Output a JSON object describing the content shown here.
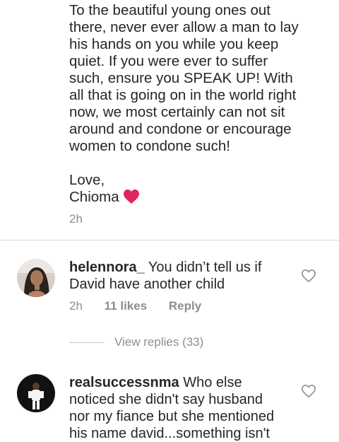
{
  "post": {
    "lines": [
      "To the beautiful young ones out",
      "there, never ever allow a man to lay",
      "his hands on you while you keep",
      "quiet. If you were ever to suffer",
      "such, ensure you SPEAK UP! With",
      "all that is going on in the world right",
      "now, we most certainly can not sit",
      "around and condone or encourage",
      "women to condone such!"
    ],
    "signoff": "Love,",
    "signature": "Chioma",
    "time": "2h"
  },
  "comments": [
    {
      "username": "helennora_",
      "lines": [
        "You didn’t tell us if",
        "David have another child"
      ],
      "time": "2h",
      "likes": "11 likes",
      "reply": "Reply"
    },
    {
      "username": "realsuccessnma",
      "lines": [
        "Who else",
        "noticed she didn't say husband",
        "nor my fiance but she mentioned",
        "his name david...something isn't"
      ]
    }
  ],
  "view_replies": "View replies (33)",
  "colors": {
    "heart": "#e0245e",
    "meta": "#8e8e8e",
    "text": "#262626"
  },
  "icons": {
    "like": "heart-outline-icon",
    "signature_emoji": "red-heart-icon"
  }
}
